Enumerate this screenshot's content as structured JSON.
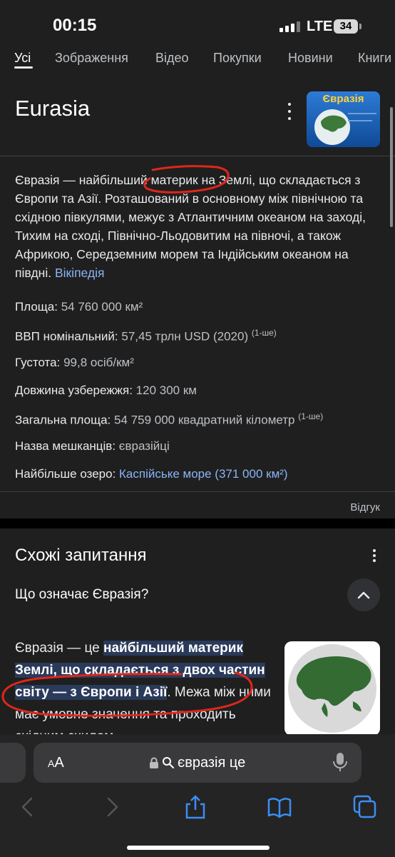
{
  "status_bar": {
    "time": "00:15",
    "network": "LTE",
    "battery": "34"
  },
  "tabs": [
    "Усі",
    "Зображення",
    "Відео",
    "Покупки",
    "Новини",
    "Книги"
  ],
  "knowledge_panel": {
    "title": "Eurasia",
    "thumbnail_label": "Євразія",
    "description": "Євразія — найбільший материк на Землі, що складається з Європи та Азії. Розташований в основному між північною та східною півкулями, межує з Атлантичним океаном на заході, Тихим на сході, Північно-Льодовитим на півночі, а також Африкою, Середземним морем та Індійським океаном на півдні.",
    "source_link": "Вікіпедія",
    "facts": [
      {
        "label": "Площа:",
        "value": "54 760 000 км²",
        "note": ""
      },
      {
        "label": "ВВП номінальний:",
        "value": "57,45 трлн USD (2020)",
        "note": "(1-ше)"
      },
      {
        "label": "Густота:",
        "value": "99,8 осіб/км²",
        "note": ""
      },
      {
        "label": "Довжина узбережжя:",
        "value": "120 300 км",
        "note": ""
      },
      {
        "label": "Загальна площа:",
        "value": "54 759 000 квадратний кілометр",
        "note": "(1-ше)"
      },
      {
        "label": "Назва мешканців:",
        "value": "євразійці",
        "note": ""
      },
      {
        "label": "Найбільше озеро:",
        "value": "Каспійське море (371 000 км²)",
        "note": ""
      }
    ],
    "feedback": "Відгук"
  },
  "paa": {
    "title": "Схожі запитання",
    "question": "Що означає Євразія?",
    "answer_prefix": "Євразія — це ",
    "answer_highlight": "найбільший материк Землі, що складається з двох частин світу — з Європи і Азії",
    "answer_suffix": ". Межа між ними має умовне значення та проходить східним схилом"
  },
  "browser": {
    "aa_label": "AA",
    "address": "євразія це"
  },
  "colors": {
    "link": "#8ab4f8",
    "annotation": "#e0261b",
    "highlight": "#2a3a5a"
  }
}
